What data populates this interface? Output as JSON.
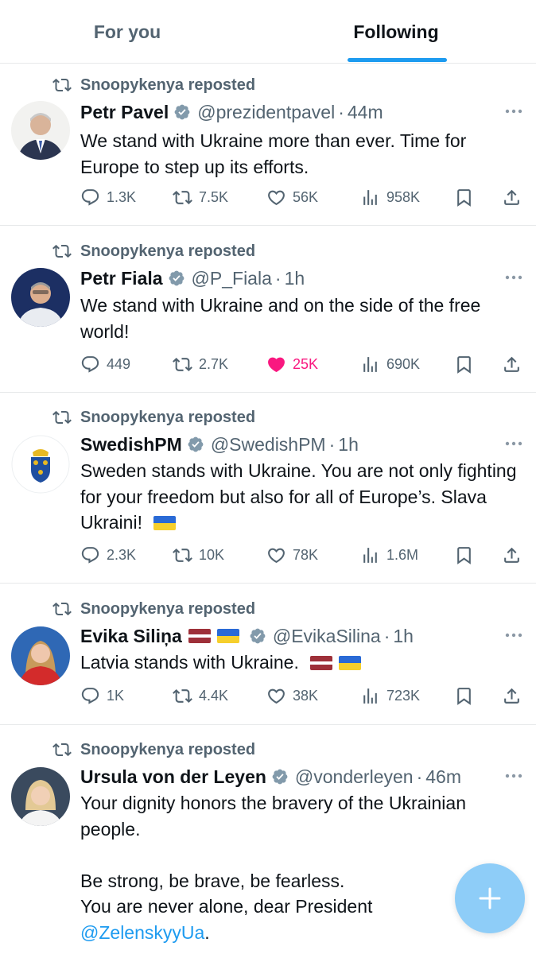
{
  "tabs": {
    "for_you": "For you",
    "following": "Following"
  },
  "tweets": [
    {
      "reposted_by": "Snoopykenya reposted",
      "name": "Petr Pavel",
      "handle": "@prezidentpavel",
      "time": "44m",
      "text": [
        "We stand with Ukraine more than ever. Time for Europe to step up its efforts."
      ],
      "replies": "1.3K",
      "reposts": "7.5K",
      "likes": "56K",
      "views": "958K",
      "liked": false
    },
    {
      "reposted_by": "Snoopykenya reposted",
      "name": "Petr Fiala",
      "handle": "@P_Fiala",
      "time": "1h",
      "text": [
        "We stand with Ukraine and on the side of the free world!"
      ],
      "replies": "449",
      "reposts": "2.7K",
      "likes": "25K",
      "views": "690K",
      "liked": true
    },
    {
      "reposted_by": "Snoopykenya reposted",
      "name": "SwedishPM",
      "handle": "@SwedishPM",
      "time": "1h",
      "text": [
        "Sweden stands with Ukraine. You are not only fighting for your freedom but also for all of Europe’s. Slava Ukraini!"
      ],
      "replies": "2.3K",
      "reposts": "10K",
      "likes": "78K",
      "views": "1.6M",
      "liked": false
    },
    {
      "reposted_by": "Snoopykenya reposted",
      "name": "Evika Siliņa",
      "handle": "@EvikaSilina",
      "time": "1h",
      "text": [
        "Latvia stands with Ukraine."
      ],
      "replies": "1K",
      "reposts": "4.4K",
      "likes": "38K",
      "views": "723K",
      "liked": false
    },
    {
      "reposted_by": "Snoopykenya reposted",
      "name": "Ursula von der Leyen",
      "handle": "@vonderleyen",
      "time": "46m",
      "text": [
        "Your dignity honors the bravery of the Ukrainian people.",
        "Be strong, be brave, be fearless.",
        "You are never alone, dear President"
      ],
      "mention": "@ZelenskyyUa",
      "mention_suffix": ".",
      "liked": false
    }
  ],
  "icons": {
    "repost": "repost-icon",
    "verified": "verified-badge-icon",
    "more": "more-icon",
    "reply": "reply-icon",
    "like": "heart-icon",
    "views": "views-icon",
    "bookmark": "bookmark-icon",
    "share": "share-icon",
    "compose": "plus-icon"
  },
  "colors": {
    "accent": "#1d9bf0",
    "like": "#f91880",
    "muted": "#536471",
    "fab": "#8ecdf8"
  }
}
